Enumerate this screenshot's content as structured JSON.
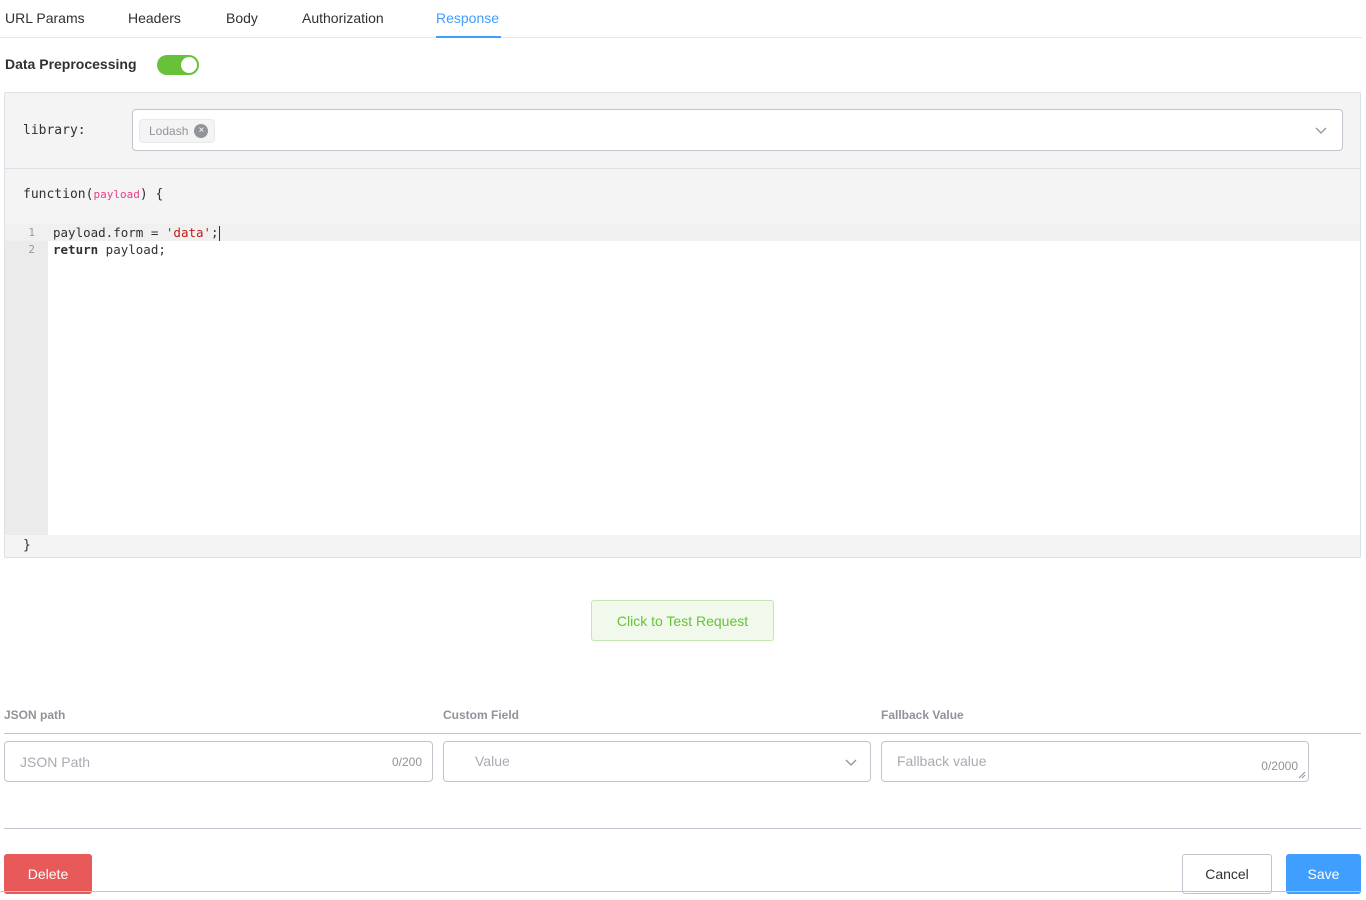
{
  "tabs": [
    {
      "label": "URL Params"
    },
    {
      "label": "Headers"
    },
    {
      "label": "Body"
    },
    {
      "label": "Authorization"
    },
    {
      "label": "Response",
      "active": true
    }
  ],
  "preprocessing": {
    "label": "Data Preprocessing",
    "enabled": true,
    "color": "#67c23a"
  },
  "library": {
    "label": "library:",
    "selected_tag": "Lodash",
    "tag_close_icon": "close-circle-icon",
    "dropdown_icon": "chevron-down-icon"
  },
  "editor": {
    "fn_open": "function(",
    "param": "payload",
    "fn_open_end": ") {",
    "lines": [
      {
        "number": "1",
        "plain": "payload.form = ",
        "string": "'data'",
        "tail": ";"
      },
      {
        "number": "2",
        "keyword": "return",
        "plain": " payload;"
      }
    ],
    "fn_close": "}"
  },
  "test_button": {
    "label": "Click to Test Request"
  },
  "mapping": {
    "json_path": {
      "label": "JSON path",
      "placeholder": "JSON Path",
      "counter": "0/200"
    },
    "custom_field": {
      "label": "Custom Field",
      "placeholder": "Value"
    },
    "fallback": {
      "label": "Fallback Value",
      "placeholder": "Fallback value",
      "counter": "0/2000"
    }
  },
  "footer": {
    "delete_label": "Delete",
    "cancel_label": "Cancel",
    "save_label": "Save"
  },
  "colors": {
    "accent": "#409eff",
    "danger": "#e85a5a",
    "success": "#67c23a"
  }
}
